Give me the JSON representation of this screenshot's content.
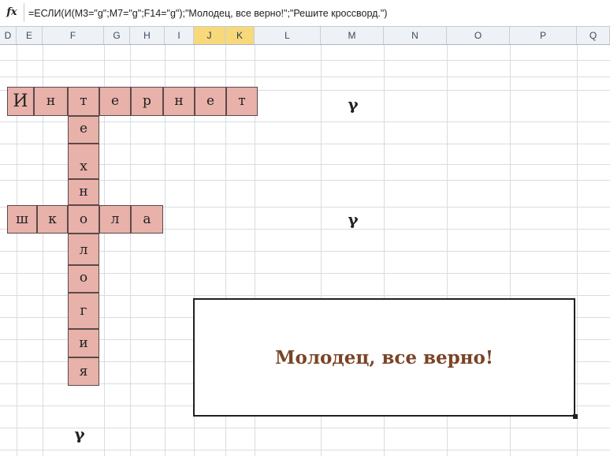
{
  "formula_bar": {
    "icon": "fx-icon",
    "formula": "=ЕСЛИ(И(M3=\"g\";M7=\"g\";F14=\"g\");\"Молодец, все верно!\";\"Решите кроссворд.\")"
  },
  "columns": [
    "D",
    "E",
    "F",
    "G",
    "H",
    "I",
    "J",
    "K",
    "L",
    "M",
    "N",
    "O",
    "P",
    "Q"
  ],
  "selected_columns": [
    "J",
    "K"
  ],
  "crossword": {
    "across_1": [
      "И",
      "н",
      "т",
      "е",
      "р",
      "н",
      "е",
      "т"
    ],
    "down": [
      "т",
      "е",
      "х",
      "н",
      "о",
      "л",
      "о",
      "г",
      "и",
      "я"
    ],
    "across_2": [
      "ш",
      "к",
      "о",
      "л",
      "а"
    ]
  },
  "check_marks": [
    "γ",
    "γ",
    "γ"
  ],
  "result_message": "Молодец, все верно!",
  "colors": {
    "cell_fill": "#e8b1aa",
    "cell_border": "#5a4a48",
    "header_selected": "#f7d87a",
    "result_text": "#7a4427"
  }
}
